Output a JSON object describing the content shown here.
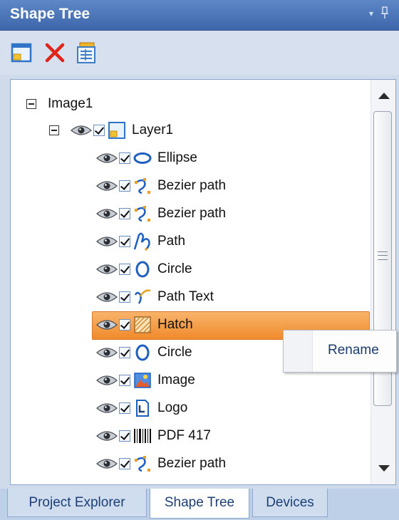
{
  "window": {
    "title": "Shape Tree",
    "dropdown_glyph": "▾",
    "pin_glyph": "ᚌ"
  },
  "toolbar": {
    "buttons": [
      {
        "name": "new-layer-button",
        "icon": "new-layer-icon"
      },
      {
        "name": "delete-button",
        "icon": "delete-x-icon"
      },
      {
        "name": "properties-button",
        "icon": "properties-icon"
      }
    ]
  },
  "tree": {
    "root": {
      "label": "Image1"
    },
    "layer": {
      "label": "Layer1"
    },
    "items": [
      {
        "label": "Ellipse",
        "icon": "ellipse-icon"
      },
      {
        "label": "Bezier path",
        "icon": "bezier-path-icon"
      },
      {
        "label": "Bezier path",
        "icon": "bezier-path-icon"
      },
      {
        "label": "Path",
        "icon": "path-icon"
      },
      {
        "label": "Circle",
        "icon": "circle-icon"
      },
      {
        "label": "Path Text",
        "icon": "path-text-icon"
      },
      {
        "label": "Hatch",
        "icon": "hatch-icon",
        "selected": true
      },
      {
        "label": "Circle",
        "icon": "circle-icon"
      },
      {
        "label": "Image",
        "icon": "image-icon"
      },
      {
        "label": "Logo",
        "icon": "logo-icon"
      },
      {
        "label": "PDF 417",
        "icon": "barcode-icon"
      },
      {
        "label": "Bezier path",
        "icon": "bezier-path-icon"
      }
    ]
  },
  "context_menu": {
    "rename_label": "Rename"
  },
  "tabs": [
    {
      "label": "Project Explorer",
      "active": false
    },
    {
      "label": "Shape Tree",
      "active": true
    },
    {
      "label": "Devices",
      "active": false
    }
  ],
  "colors": {
    "title_bar": "#4a76b9",
    "selection": "#f39a3f",
    "tab_text": "#1d3f76",
    "delete_red": "#e0241b"
  }
}
